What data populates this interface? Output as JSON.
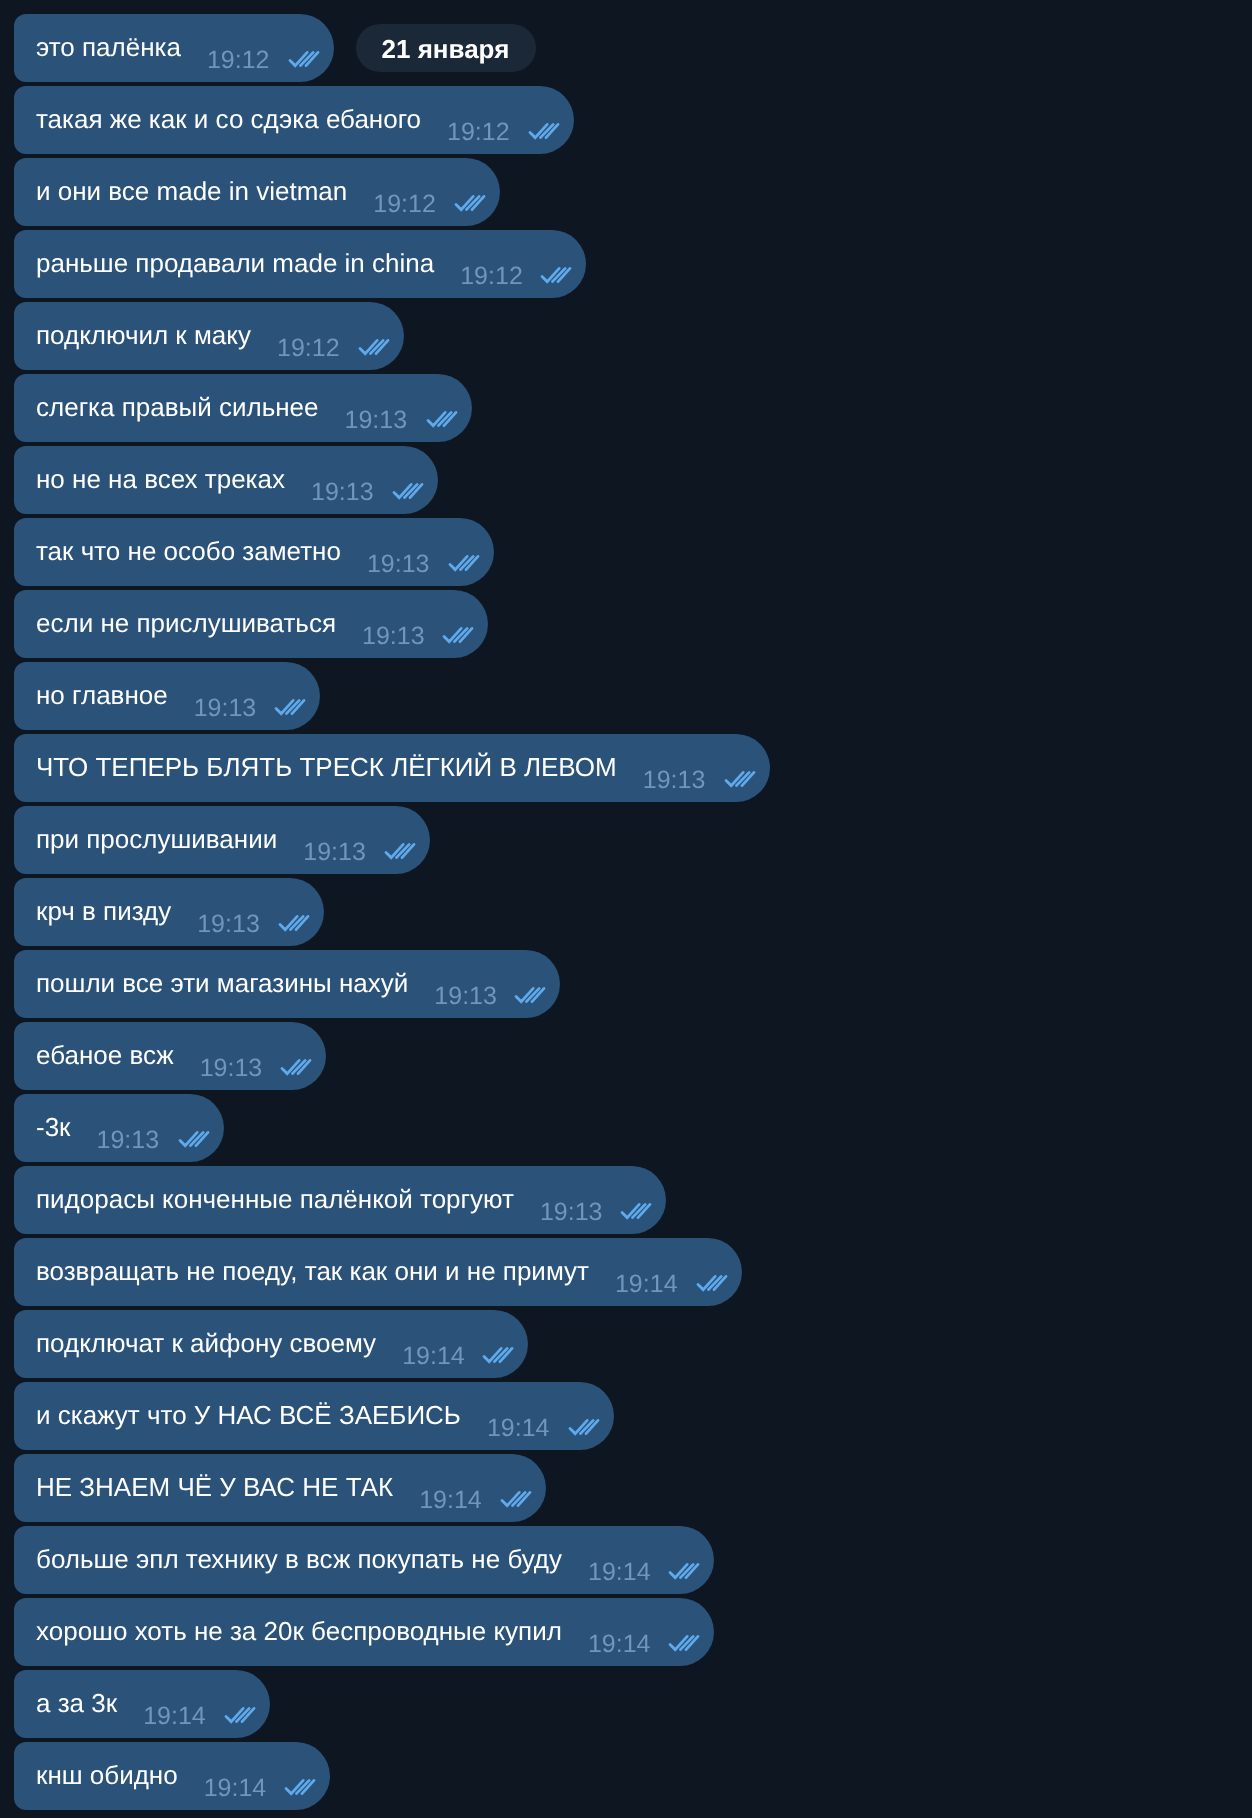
{
  "date_badge": {
    "text": "21 января"
  },
  "messages": [
    {
      "text": "это палёнка",
      "time": "19:12",
      "read": true
    },
    {
      "text": "такая же как и со сдэка ебаного",
      "time": "19:12",
      "read": true
    },
    {
      "text": "и они все made in vietman",
      "time": "19:12",
      "read": true
    },
    {
      "text": "раньше продавали made in china",
      "time": "19:12",
      "read": true
    },
    {
      "text": "подключил к маку",
      "time": "19:12",
      "read": true
    },
    {
      "text": "слегка правый сильнее",
      "time": "19:13",
      "read": true
    },
    {
      "text": "но не на всех треках",
      "time": "19:13",
      "read": true
    },
    {
      "text": "так что не особо заметно",
      "time": "19:13",
      "read": true
    },
    {
      "text": "если не прислушиваться",
      "time": "19:13",
      "read": true
    },
    {
      "text": "но главное",
      "time": "19:13",
      "read": true
    },
    {
      "text": "ЧТО ТЕПЕРЬ БЛЯТЬ ТРЕСК ЛЁГКИЙ В ЛЕВОМ",
      "time": "19:13",
      "read": true
    },
    {
      "text": "при прослушивании",
      "time": "19:13",
      "read": true
    },
    {
      "text": "крч в пизду",
      "time": "19:13",
      "read": true
    },
    {
      "text": "пошли все эти магазины нахуй",
      "time": "19:13",
      "read": true
    },
    {
      "text": "ебаное всж",
      "time": "19:13",
      "read": true
    },
    {
      "text": "-3к",
      "time": "19:13",
      "read": true
    },
    {
      "text": "пидорасы конченные палёнкой торгуют",
      "time": "19:13",
      "read": true
    },
    {
      "text": "возвращать не поеду, так как они и не примут",
      "time": "19:14",
      "read": true
    },
    {
      "text": "подключат к айфону своему",
      "time": "19:14",
      "read": true
    },
    {
      "text": "и скажут что У НАС ВСЁ ЗАЕБИСЬ",
      "time": "19:14",
      "read": true
    },
    {
      "text": "НЕ ЗНАЕМ ЧЁ У ВАС НЕ ТАК",
      "time": "19:14",
      "read": true
    },
    {
      "text": "больше эпл технику в всж покупать не буду",
      "time": "19:14",
      "read": true
    },
    {
      "text": "хорошо хоть не за 20к беспроводные купил",
      "time": "19:14",
      "read": true
    },
    {
      "text": "а за 3к",
      "time": "19:14",
      "read": true
    },
    {
      "text": "кнш обидно",
      "time": "19:14",
      "read": true
    }
  ]
}
